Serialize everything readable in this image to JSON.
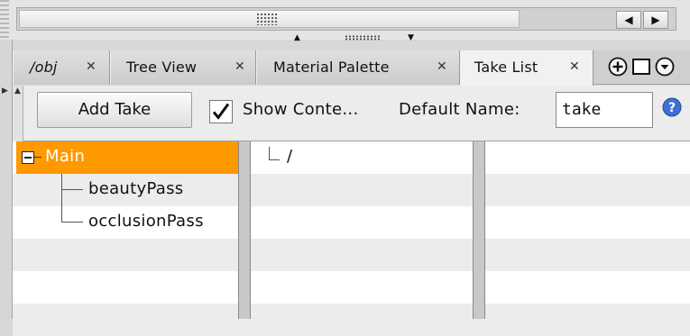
{
  "tabs": [
    {
      "label": "/obj",
      "active": false
    },
    {
      "label": "Tree View",
      "active": false
    },
    {
      "label": "Material Palette",
      "active": false
    },
    {
      "label": "Take List",
      "active": true
    }
  ],
  "toolbar": {
    "add_take_label": "Add Take",
    "show_contents_label": "Show Conte...",
    "show_contents_checked": true,
    "default_name_label": "Default Name:",
    "default_name_value": "take"
  },
  "take_tree": {
    "root": {
      "label": "Main",
      "expanded": true,
      "selected": true,
      "children": [
        "beautyPass",
        "occlusionPass"
      ]
    }
  },
  "contents_pane": {
    "path": "/"
  },
  "icons": [
    "grip-icon",
    "arrow-left-icon",
    "arrow-right-icon",
    "arrow-up-icon",
    "arrow-down-icon",
    "close-icon",
    "add-pane-icon",
    "maximize-icon",
    "menu-icon",
    "checkmark-icon",
    "help-icon",
    "collapse-icon"
  ],
  "colors": {
    "selection": "#ff9900",
    "help": "#3f6fd1"
  }
}
